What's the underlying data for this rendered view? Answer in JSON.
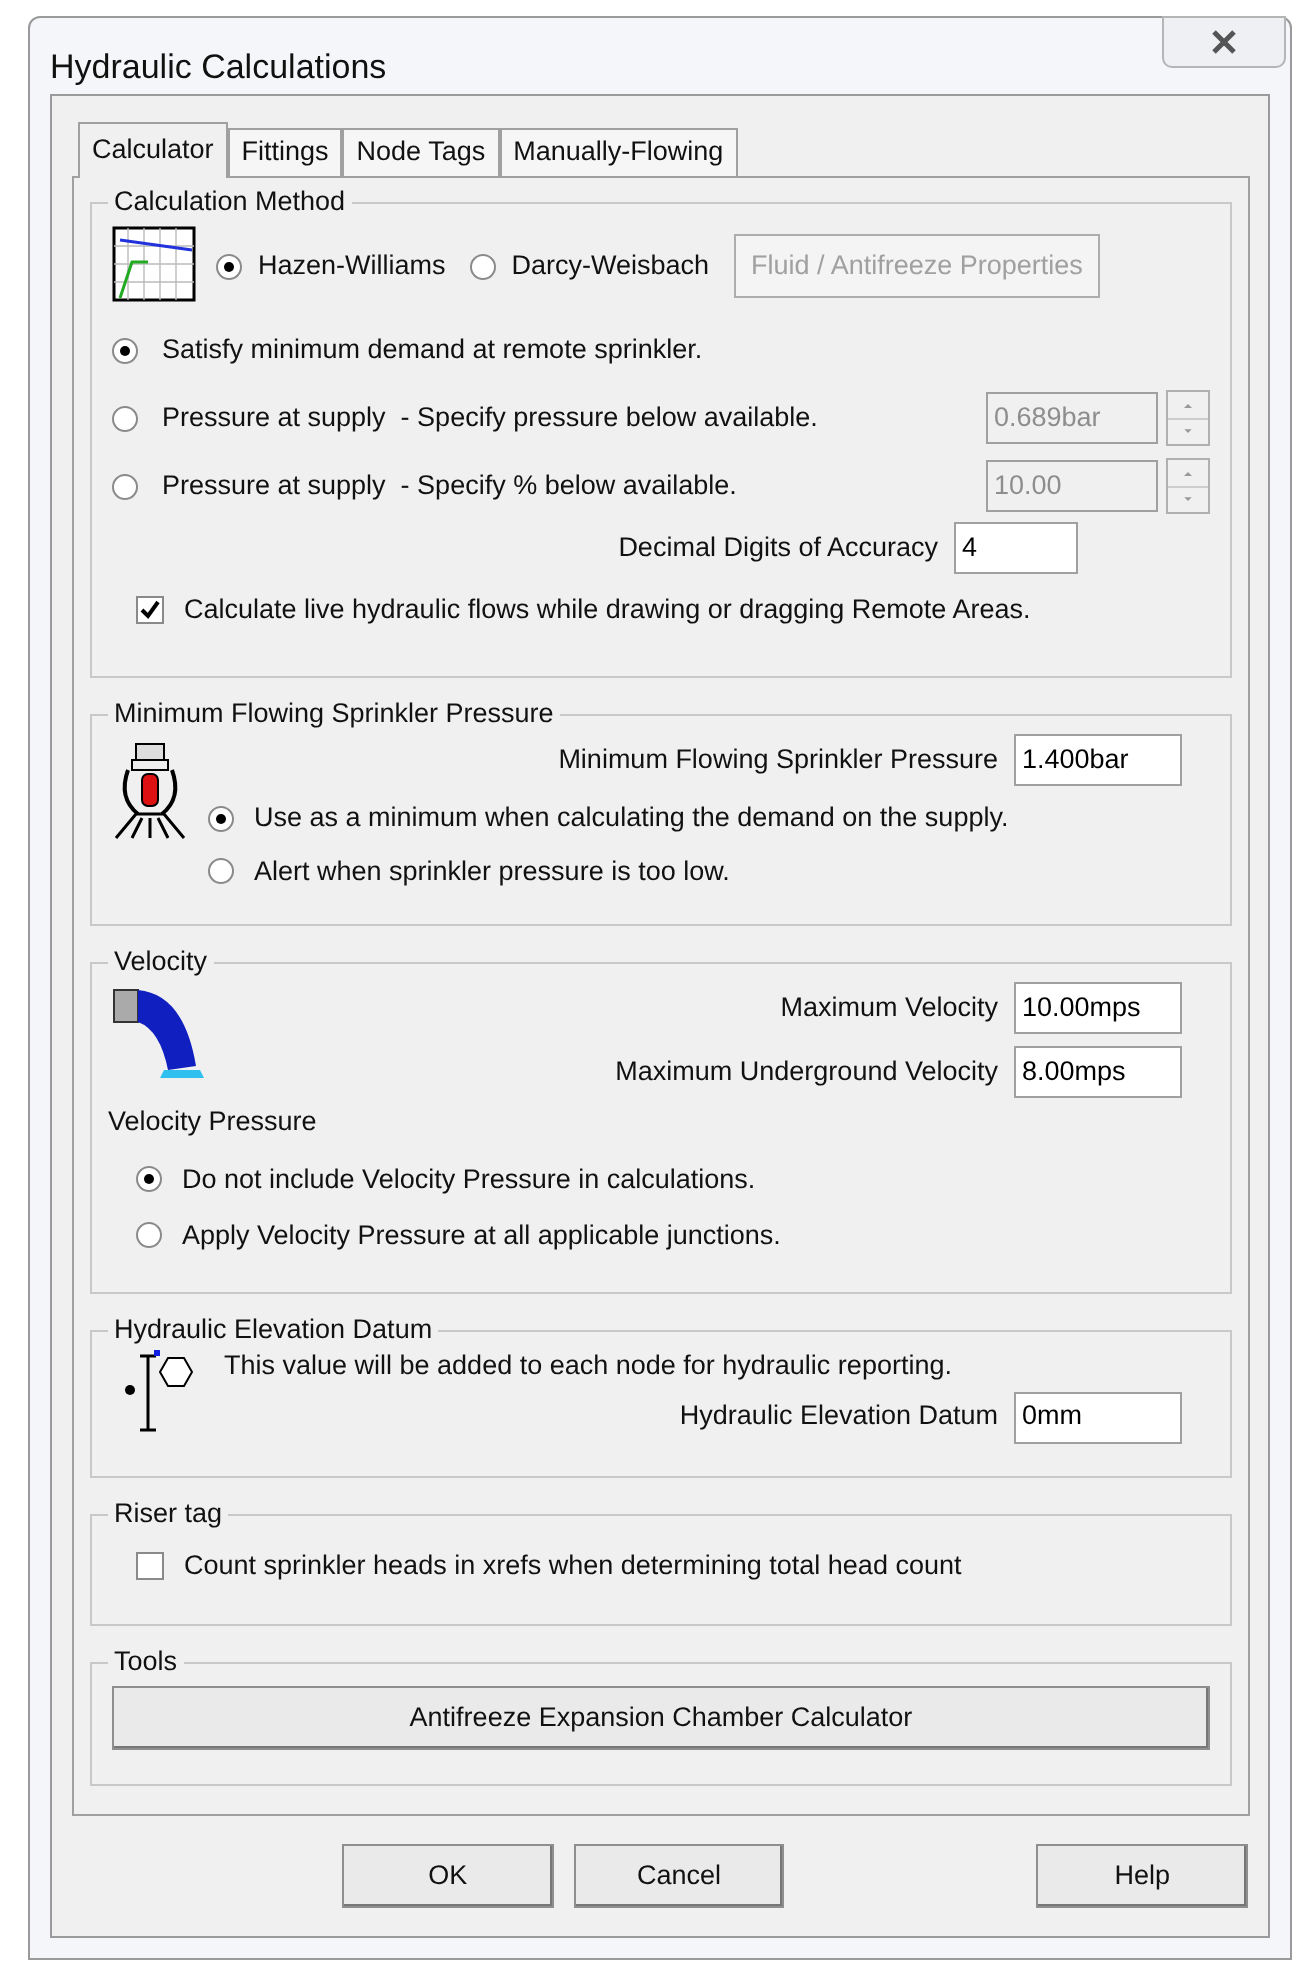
{
  "window": {
    "title": "Hydraulic Calculations"
  },
  "tabs": [
    {
      "label": "Calculator",
      "selected": true
    },
    {
      "label": "Fittings",
      "selected": false
    },
    {
      "label": "Node Tags",
      "selected": false
    },
    {
      "label": "Manually-Flowing",
      "selected": false
    }
  ],
  "calculation_method": {
    "legend": "Calculation Method",
    "methods": [
      {
        "label": "Hazen-Williams",
        "selected": true
      },
      {
        "label": "Darcy-Weisbach",
        "selected": false
      }
    ],
    "fluid_button": {
      "label": "Fluid / Antifreeze Properties",
      "disabled": true
    },
    "modes": [
      {
        "label": "Satisfy minimum demand at remote sprinkler.",
        "selected": true
      },
      {
        "label": "Pressure at supply  - Specify pressure below available.",
        "selected": false,
        "field": {
          "value": "0.689bar",
          "disabled": true
        }
      },
      {
        "label": "Pressure at supply  - Specify % below available.",
        "selected": false,
        "field": {
          "value": "10.00",
          "disabled": true
        }
      }
    ],
    "accuracy": {
      "label": "Decimal Digits of Accuracy",
      "value": "4"
    },
    "live_calc": {
      "label": "Calculate live hydraulic flows while drawing or dragging Remote Areas.",
      "checked": true
    }
  },
  "min_pressure": {
    "legend": "Minimum Flowing Sprinkler Pressure",
    "label": "Minimum Flowing Sprinkler Pressure",
    "value": "1.400bar",
    "options": [
      {
        "label": "Use as a minimum when calculating the demand on the supply.",
        "selected": true
      },
      {
        "label": "Alert when sprinkler pressure is too low.",
        "selected": false
      }
    ]
  },
  "velocity": {
    "legend": "Velocity",
    "fields": [
      {
        "label": "Maximum Velocity",
        "value": "10.00mps"
      },
      {
        "label": "Maximum Underground Velocity",
        "value": "8.00mps"
      }
    ],
    "pressure_heading": "Velocity Pressure",
    "options": [
      {
        "label": "Do not include Velocity Pressure in calculations.",
        "selected": true
      },
      {
        "label": "Apply Velocity Pressure at all applicable junctions.",
        "selected": false
      }
    ]
  },
  "elevation": {
    "legend": "Hydraulic Elevation Datum",
    "note": "This value will be added to each node for hydraulic reporting.",
    "label": "Hydraulic Elevation Datum",
    "value": "0mm"
  },
  "riser_tag": {
    "legend": "Riser tag",
    "option": {
      "label": "Count sprinkler heads in xrefs when determining total head count",
      "checked": false
    }
  },
  "tools": {
    "legend": "Tools",
    "button": "Antifreeze Expansion Chamber Calculator"
  },
  "buttons": [
    "OK",
    "Cancel",
    "Help"
  ]
}
